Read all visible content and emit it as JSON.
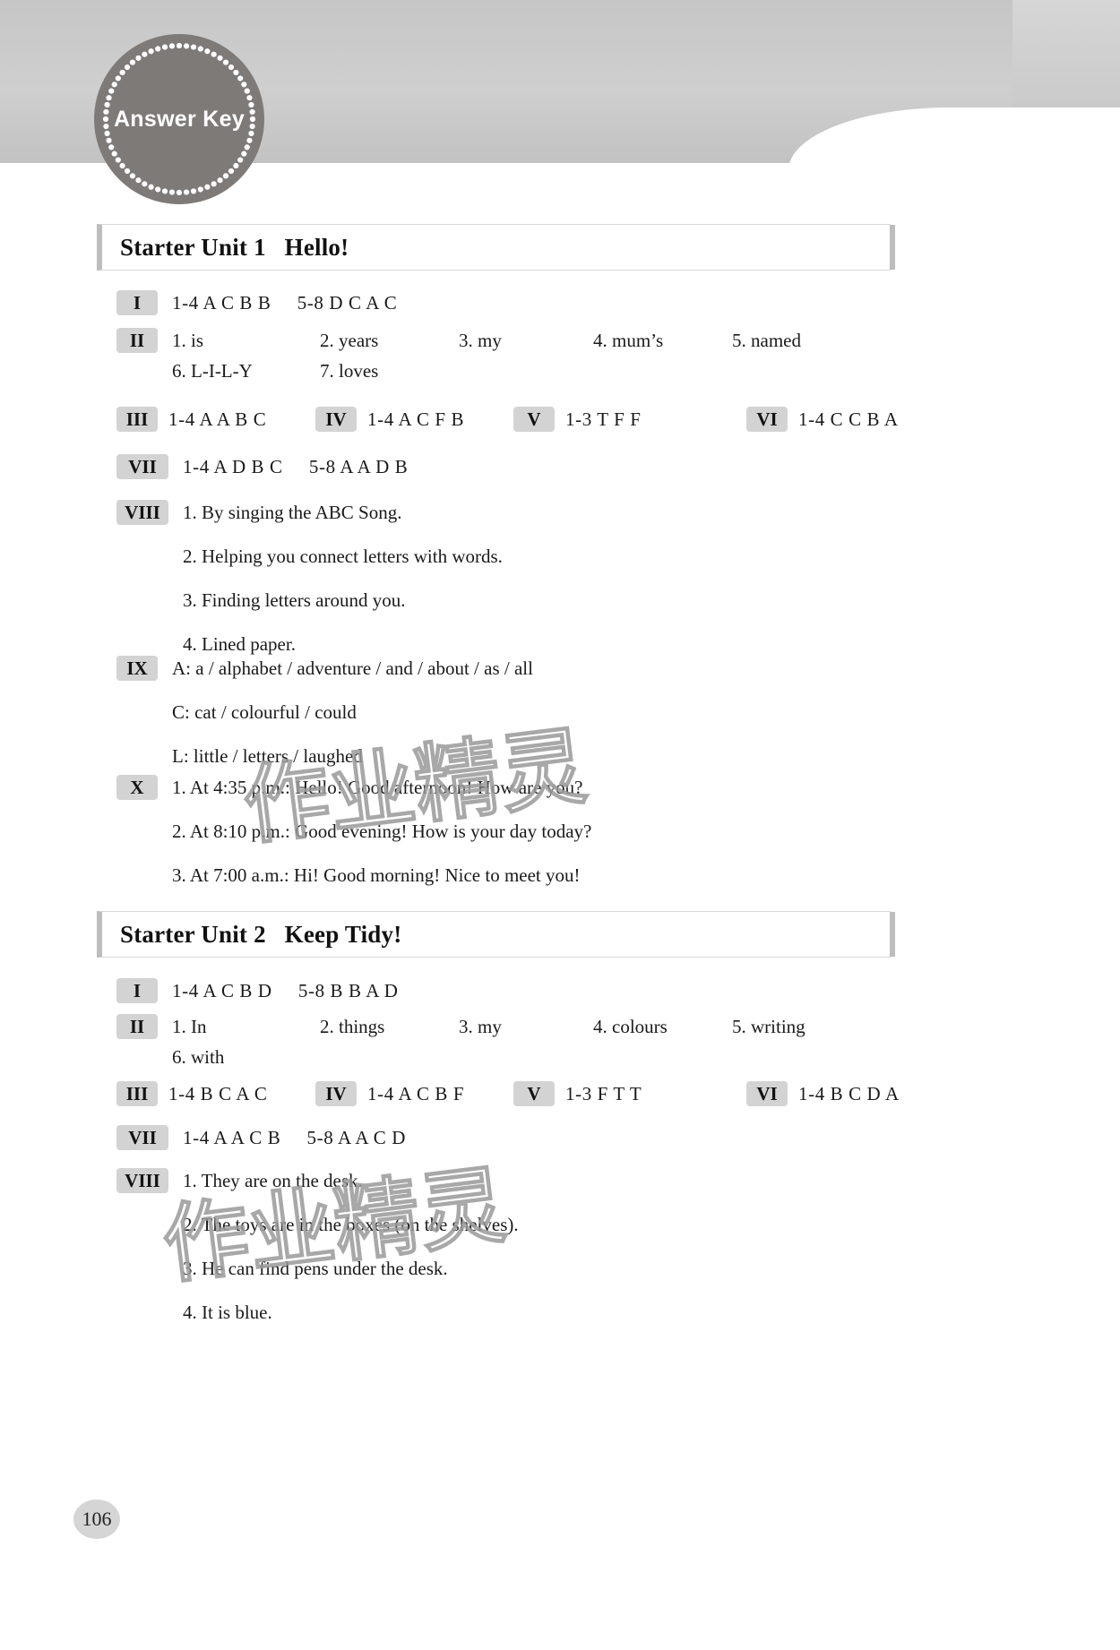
{
  "banner": {
    "badge_label": "Answer Key"
  },
  "page_number": "106",
  "watermark": {
    "text": "作业精灵"
  },
  "units": [
    {
      "id": "starter-unit-1",
      "title": "Starter Unit 1   Hello!",
      "sections": [
        {
          "numeral": "I",
          "type": "single",
          "text": "1-4 A C B B     5-8 D C A C"
        },
        {
          "numeral": "II",
          "type": "fill",
          "items": [
            "1. is",
            "2. years",
            "3. my",
            "4. mum’s",
            "5. named"
          ],
          "items2": [
            "6. L-I-L-Y",
            "7. loves"
          ]
        },
        {
          "numeral": "III",
          "type": "inline-row",
          "cells": [
            {
              "numeral": "III",
              "text": "1-4 A A B C"
            },
            {
              "numeral": "IV",
              "text": "1-4 A C F B"
            },
            {
              "numeral": "V",
              "text": "1-3 T F F"
            },
            {
              "numeral": "VI",
              "text": "1-4 C C B A"
            }
          ]
        },
        {
          "numeral": "VII",
          "type": "single",
          "text": "1-4 A D B C     5-8 A A D B"
        },
        {
          "numeral": "VIII",
          "type": "multi",
          "lines": [
            "1. By singing the ABC Song.",
            "2. Helping you connect letters with words.",
            "3. Finding letters around you.",
            "4. Lined paper."
          ]
        },
        {
          "numeral": "IX",
          "type": "multi",
          "lines": [
            "A: a / alphabet / adventure / and / about / as / all",
            "C: cat / colourful / could",
            "L: little / letters / laughed"
          ]
        },
        {
          "numeral": "X",
          "type": "multi",
          "lines": [
            "1. At 4:35 p.m.: Hello! Good afternoon! How are you?",
            "2. At 8:10 p.m.: Good evening! How is your day today?",
            "3. At 7:00 a.m.: Hi! Good morning! Nice to meet you!"
          ]
        }
      ]
    },
    {
      "id": "starter-unit-2",
      "title": "Starter Unit 2   Keep Tidy!",
      "sections": [
        {
          "numeral": "I",
          "type": "single",
          "text": "1-4 A C B D     5-8 B B A D"
        },
        {
          "numeral": "II",
          "type": "fill",
          "items": [
            "1. In",
            "2. things",
            "3. my",
            "4. colours",
            "5. writing"
          ],
          "items2": [
            "6. with"
          ]
        },
        {
          "numeral": "III",
          "type": "inline-row",
          "cells": [
            {
              "numeral": "III",
              "text": "1-4 B C A C"
            },
            {
              "numeral": "IV",
              "text": "1-4 A C B F"
            },
            {
              "numeral": "V",
              "text": "1-3 F T T"
            },
            {
              "numeral": "VI",
              "text": "1-4 B C D A"
            }
          ]
        },
        {
          "numeral": "VII",
          "type": "single",
          "text": "1-4 A A C B     5-8 A A C D"
        },
        {
          "numeral": "VIII",
          "type": "multi",
          "lines": [
            "1. They are on the desk.",
            "2. The toys are in the boxes (on the shelves).",
            "3. He can find pens under the desk.",
            "4. It is blue."
          ]
        }
      ]
    }
  ]
}
